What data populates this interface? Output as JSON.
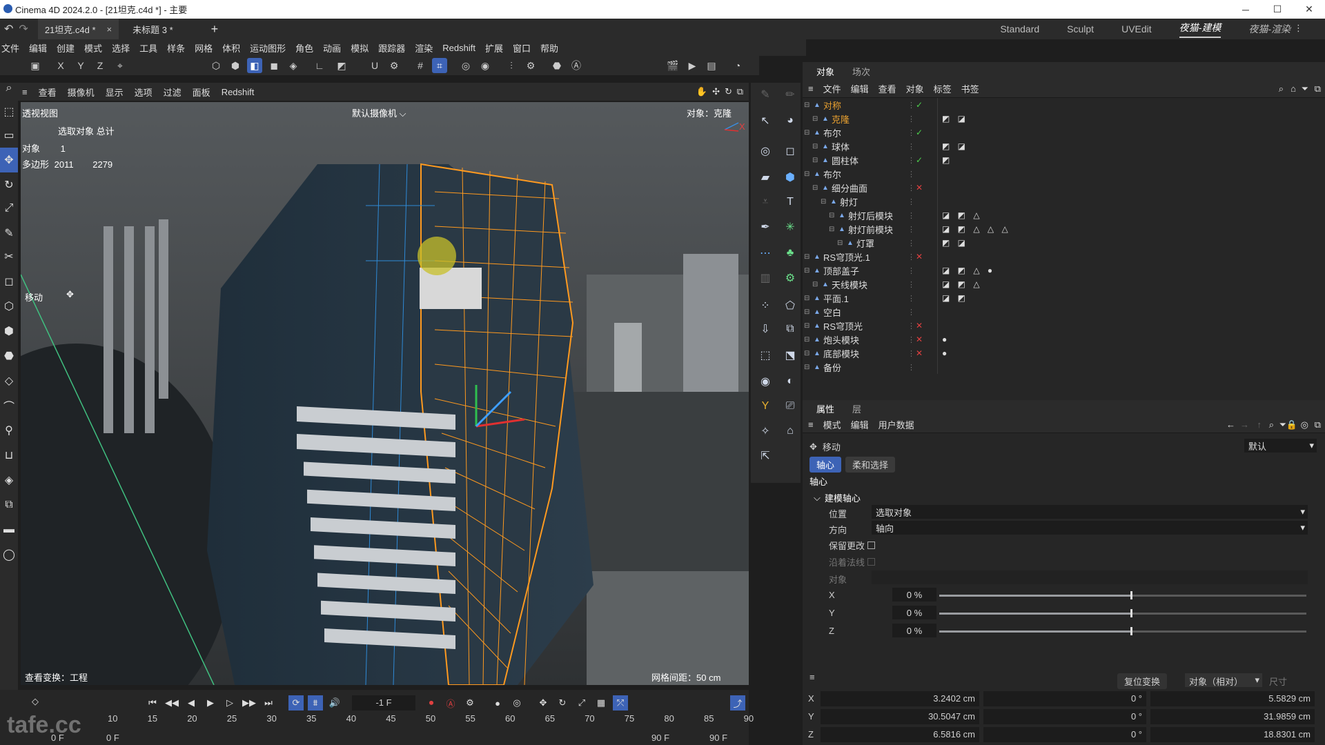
{
  "window": {
    "title": "Cinema 4D 2024.2.0 - [21坦克.c4d *] - 主要"
  },
  "doc_tabs": [
    {
      "label": "21坦克.c4d *",
      "close": "×"
    },
    {
      "label": "未标题 3 *"
    }
  ],
  "new_tab": "+",
  "layouts": [
    "Standard",
    "Sculpt",
    "UVEdit",
    "夜猫-建模",
    "夜猫-渲染"
  ],
  "menu": [
    "文件",
    "编辑",
    "创建",
    "模式",
    "选择",
    "工具",
    "样条",
    "网格",
    "体积",
    "运动图形",
    "角色",
    "动画",
    "模拟",
    "跟踪器",
    "渲染",
    "Redshift",
    "扩展",
    "窗口",
    "帮助"
  ],
  "toolbar_axes": [
    "X",
    "Y",
    "Z"
  ],
  "view_menu": [
    "查看",
    "摄像机",
    "显示",
    "选项",
    "过滤",
    "面板",
    "Redshift"
  ],
  "viewport": {
    "name": "透视视图",
    "camera": "默认摄像机",
    "target": "对象：克隆",
    "stats_header": "选取对象 总计",
    "objects_label": "对象",
    "objects_value": "1",
    "polys_label": "多边形",
    "polys_selected": "2011",
    "polys_total": "2279",
    "tool_label": "移动",
    "view_transform": "查看变换：工程",
    "grid_spacing": "网格间距：50 cm",
    "axis_x": "X"
  },
  "object_panel": {
    "tabs": [
      "对象",
      "场次"
    ],
    "menu": [
      "文件",
      "编辑",
      "查看",
      "对象",
      "标签",
      "书签"
    ],
    "tree": [
      {
        "name": "对称",
        "depth": 0,
        "color": "#e8a030",
        "flag": "✓",
        "flag_color": "#4cd04c"
      },
      {
        "name": "克隆",
        "depth": 1,
        "color": "#e8a030",
        "flag": "",
        "tags": "◩ ◪"
      },
      {
        "name": "布尔",
        "depth": 0,
        "color": "#dddddd",
        "flag": "✓",
        "flag_color": "#4cd04c"
      },
      {
        "name": "球体",
        "depth": 1,
        "color": "#dddddd",
        "flag": "",
        "tags": "◩ ◪"
      },
      {
        "name": "圆柱体",
        "depth": 1,
        "color": "#dddddd",
        "flag": "✓",
        "flag_color": "#4cd04c",
        "tags": "◩"
      },
      {
        "name": "布尔",
        "depth": 0,
        "color": "#dddddd",
        "flag": ""
      },
      {
        "name": "细分曲面",
        "depth": 1,
        "color": "#dddddd",
        "flag": "✕",
        "flag_color": "#e04040"
      },
      {
        "name": "射灯",
        "depth": 2,
        "color": "#dddddd",
        "flag": ""
      },
      {
        "name": "射灯后模块",
        "depth": 3,
        "color": "#dddddd",
        "flag": "",
        "tags": "◪ ◩ △"
      },
      {
        "name": "射灯前模块",
        "depth": 3,
        "color": "#dddddd",
        "flag": "",
        "tags": "◪ ◩ △ △ △"
      },
      {
        "name": "灯罩",
        "depth": 4,
        "color": "#dddddd",
        "flag": "",
        "tags": "◩ ◪"
      },
      {
        "name": "RS穹顶光.1",
        "depth": 0,
        "color": "#dddddd",
        "flag": "✕",
        "flag_color": "#e04040"
      },
      {
        "name": "顶部盖子",
        "depth": 0,
        "color": "#dddddd",
        "flag": "",
        "tags": "◪ ◩ △ ●"
      },
      {
        "name": "天线模块",
        "depth": 1,
        "color": "#dddddd",
        "flag": "",
        "tags": "◪ ◩ △"
      },
      {
        "name": "平面.1",
        "depth": 0,
        "color": "#dddddd",
        "flag": "",
        "tags": "◪ ◩"
      },
      {
        "name": "空白",
        "depth": 0,
        "color": "#dddddd",
        "flag": ""
      },
      {
        "name": "RS穹顶光",
        "depth": 0,
        "color": "#dddddd",
        "flag": "✕",
        "flag_color": "#e04040"
      },
      {
        "name": "炮头模块",
        "depth": 0,
        "color": "#dddddd",
        "flag": "✕",
        "flag_color": "#e04040",
        "tags": "●"
      },
      {
        "name": "底部模块",
        "depth": 0,
        "color": "#dddddd",
        "flag": "✕",
        "flag_color": "#e04040",
        "tags": "●"
      },
      {
        "name": "备份",
        "depth": 0,
        "color": "#dddddd",
        "flag": ""
      }
    ]
  },
  "attributes": {
    "tabs": [
      "属性",
      "层"
    ],
    "menu": [
      "模式",
      "编辑",
      "用户数据"
    ],
    "tool_name": "移动",
    "preset": "默认",
    "subtabs": [
      "轴心",
      "柔和选择"
    ],
    "section": "轴心",
    "group": "建模轴心",
    "position_label": "位置",
    "position_value": "选取对象",
    "orientation_label": "方向",
    "orientation_value": "轴向",
    "keep_changes": "保留更改",
    "along_normal": "沿着法线",
    "object_label": "对象",
    "x_label": "X",
    "x_value": "0 %",
    "x_fill": 0.52,
    "y_label": "Y",
    "y_value": "0 %",
    "y_fill": 0.52,
    "z_label": "Z",
    "z_value": "0 %",
    "z_fill": 0.52
  },
  "coords": {
    "reset": "复位变换",
    "mode": "对象（相对）",
    "size_label": "尺寸",
    "rows": [
      {
        "axis": "X",
        "pos": "3.2402 cm",
        "rot": "0 °",
        "size": "5.5829 cm"
      },
      {
        "axis": "Y",
        "pos": "30.5047 cm",
        "rot": "0 °",
        "size": "31.9859 cm"
      },
      {
        "axis": "Z",
        "pos": "6.5816 cm",
        "rot": "0 °",
        "size": "18.8301 cm"
      }
    ]
  },
  "timeline": {
    "frame": "-1 F",
    "ticks": [
      "10",
      "15",
      "20",
      "25",
      "30",
      "35",
      "40",
      "45",
      "50",
      "55",
      "60",
      "65",
      "70",
      "75",
      "80",
      "85",
      "90"
    ],
    "start": "0 F",
    "start2": "0 F",
    "end": "90 F",
    "end2": "90 F"
  },
  "watermark": "tafe.cc",
  "colors": {
    "accent": "#3d63b6",
    "selection": "#ff9a1f"
  }
}
